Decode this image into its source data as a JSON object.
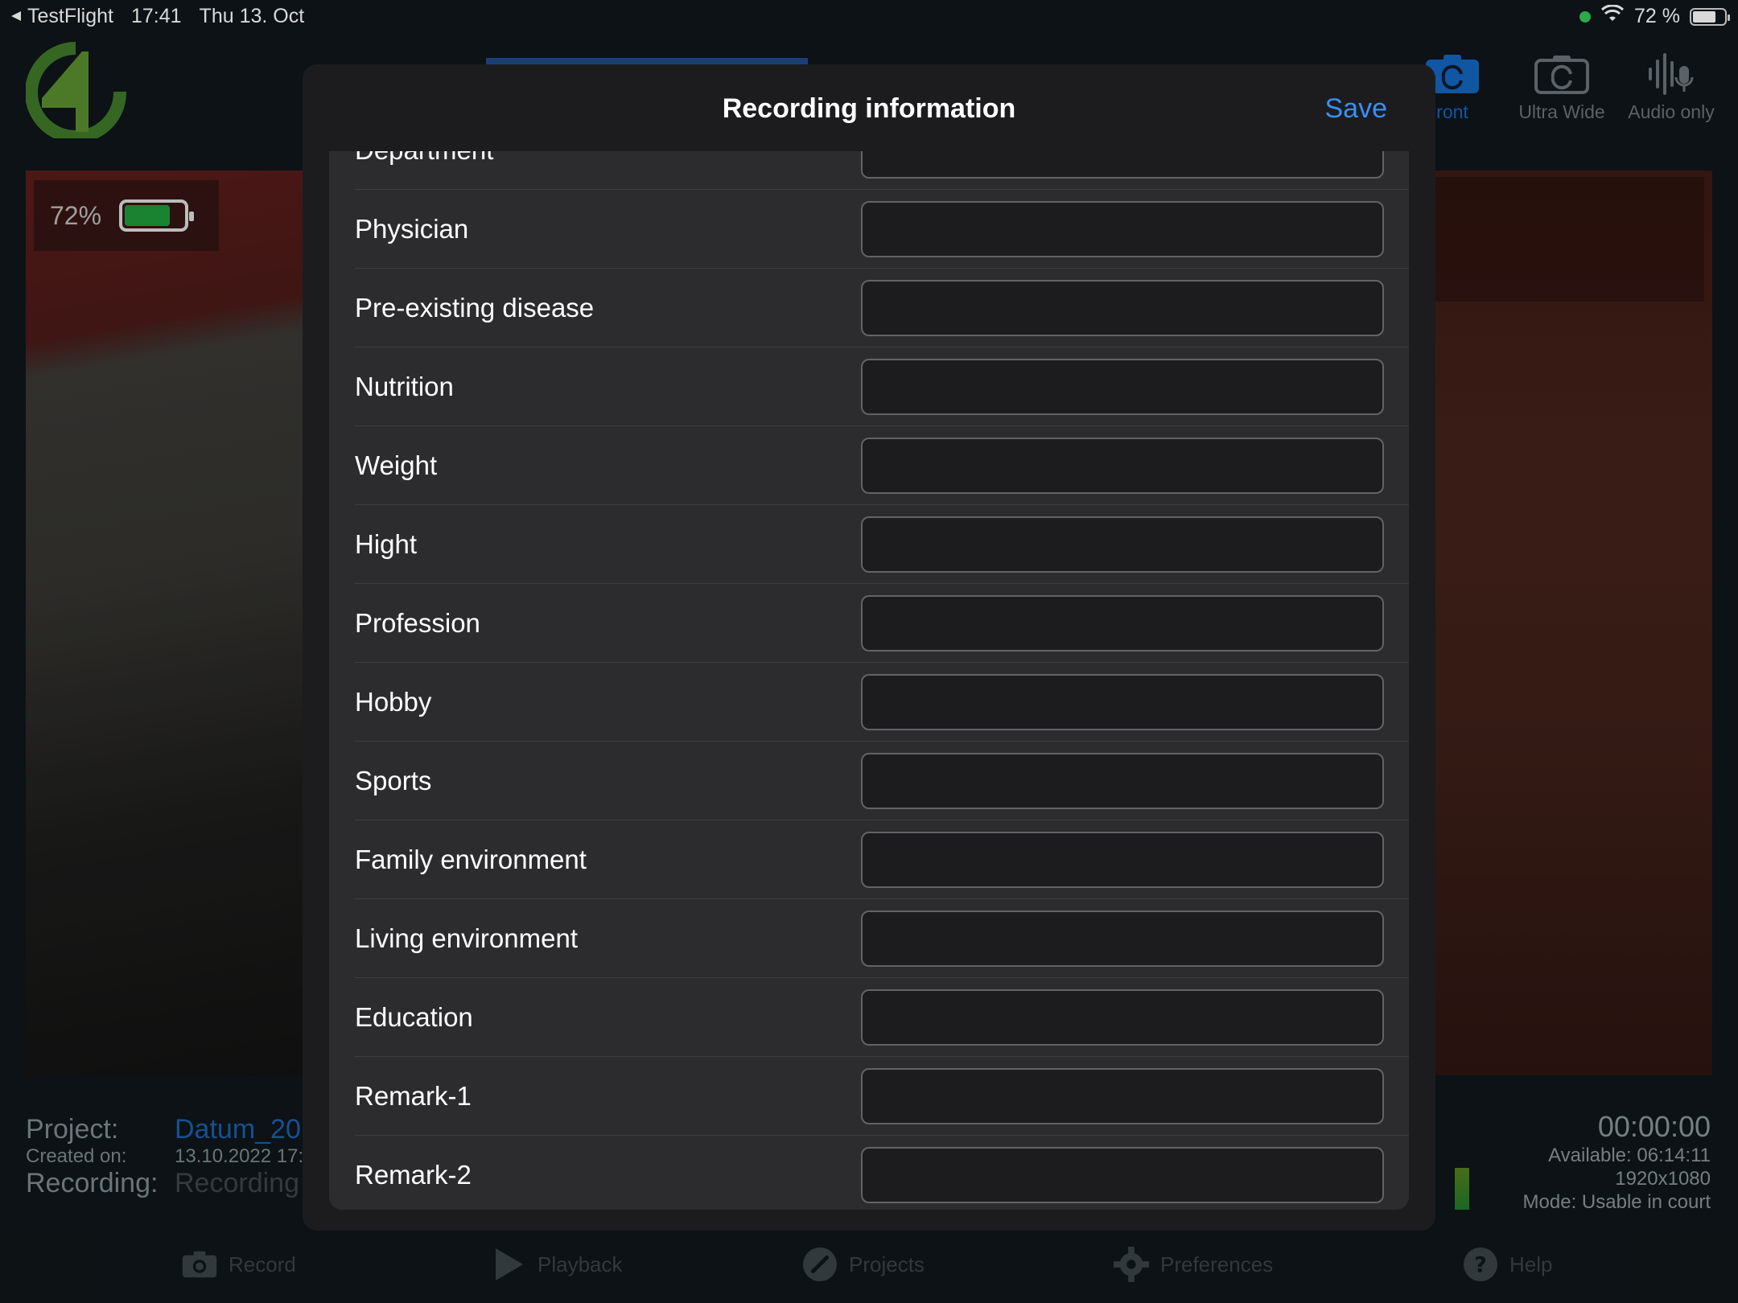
{
  "status_bar": {
    "back_app": "TestFlight",
    "time": "17:41",
    "date": "Thu 13. Oct",
    "battery": "72 %"
  },
  "camera": {
    "battery_overlay": "72%"
  },
  "top_buttons": [
    {
      "label": "ront",
      "icon": "camera-rotate-icon",
      "active": true
    },
    {
      "label": "Ultra Wide",
      "icon": "camera-rotate-icon"
    },
    {
      "label": "Audio only",
      "icon": "microphone-waveform-icon"
    }
  ],
  "info": {
    "project_label": "Project:",
    "project_value": "Datum_20",
    "created_label": "Created on:",
    "created_value": "13.10.2022 17:",
    "recording_label": "Recording:",
    "recording_value": "Recording"
  },
  "recording_stats": {
    "time": "00:00:00",
    "available": "Available: 06:14:11",
    "resolution": "1920x1080",
    "mode": "Mode: Usable in court"
  },
  "tabbar": [
    {
      "label": "Record",
      "icon": "camera-icon"
    },
    {
      "label": "Playback",
      "icon": "play-icon"
    },
    {
      "label": "Projects",
      "icon": "pencil-icon"
    },
    {
      "label": "Preferences",
      "icon": "gear-icon"
    },
    {
      "label": "Help",
      "icon": "question-icon"
    }
  ],
  "modal": {
    "title": "Recording information",
    "save_label": "Save",
    "fields": [
      {
        "label": "Department",
        "value": ""
      },
      {
        "label": "Physician",
        "value": ""
      },
      {
        "label": "Pre-existing disease",
        "value": ""
      },
      {
        "label": "Nutrition",
        "value": ""
      },
      {
        "label": "Weight",
        "value": ""
      },
      {
        "label": "Hight",
        "value": ""
      },
      {
        "label": "Profession",
        "value": ""
      },
      {
        "label": "Hobby",
        "value": ""
      },
      {
        "label": "Sports",
        "value": ""
      },
      {
        "label": "Family environment",
        "value": ""
      },
      {
        "label": "Living environment",
        "value": ""
      },
      {
        "label": "Education",
        "value": ""
      },
      {
        "label": "Remark-1",
        "value": ""
      },
      {
        "label": "Remark-2",
        "value": ""
      }
    ]
  },
  "colors": {
    "accent": "#3a8ff7",
    "modal_bg": "#1c1c1e",
    "card_bg": "#2c2c2e",
    "input_border": "#636366"
  }
}
